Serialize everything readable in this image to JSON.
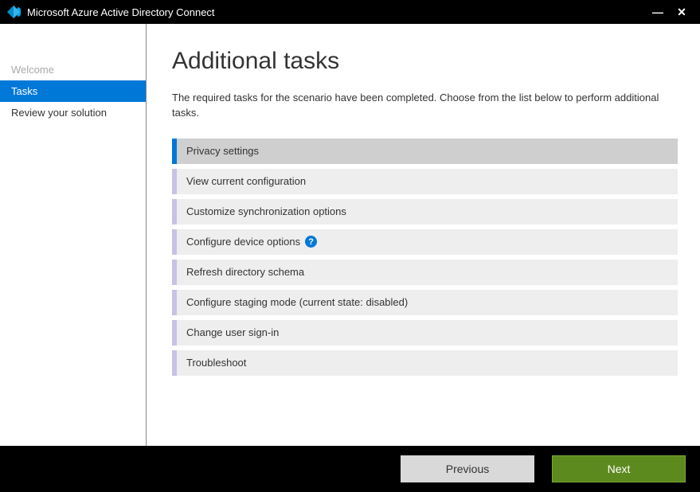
{
  "window": {
    "title": "Microsoft Azure Active Directory Connect",
    "minimize": "—",
    "close": "✕"
  },
  "sidebar": {
    "items": [
      {
        "label": "Welcome",
        "state": "disabled"
      },
      {
        "label": "Tasks",
        "state": "active"
      },
      {
        "label": "Review your solution",
        "state": "normal"
      }
    ]
  },
  "content": {
    "title": "Additional tasks",
    "description": "The required tasks for the scenario have been completed. Choose from the list below to perform additional tasks.",
    "tasks": [
      {
        "label": "Privacy settings",
        "selected": true,
        "help": false
      },
      {
        "label": "View current configuration",
        "selected": false,
        "help": false
      },
      {
        "label": "Customize synchronization options",
        "selected": false,
        "help": false
      },
      {
        "label": "Configure device options",
        "selected": false,
        "help": true
      },
      {
        "label": "Refresh directory schema",
        "selected": false,
        "help": false
      },
      {
        "label": "Configure staging mode (current state: disabled)",
        "selected": false,
        "help": false
      },
      {
        "label": "Change user sign-in",
        "selected": false,
        "help": false
      },
      {
        "label": "Troubleshoot",
        "selected": false,
        "help": false
      }
    ]
  },
  "footer": {
    "previous": "Previous",
    "next": "Next"
  },
  "help_glyph": "?"
}
